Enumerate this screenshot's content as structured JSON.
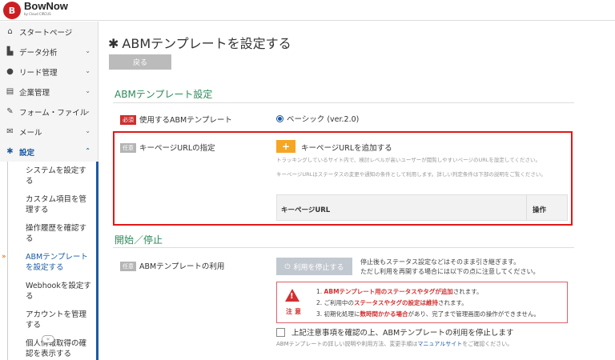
{
  "brand": {
    "name": "BowNow",
    "sub": "by Cloud CIRCUS",
    "mark": "B"
  },
  "sidebar": {
    "items": [
      {
        "label": "スタートページ",
        "icon": "home-icon",
        "glyph": "⌂",
        "chevron": false
      },
      {
        "label": "データ分析",
        "icon": "chart-icon",
        "glyph": "▙",
        "chevron": true
      },
      {
        "label": "リード管理",
        "icon": "person-icon",
        "glyph": "●",
        "chevron": true
      },
      {
        "label": "企業管理",
        "icon": "building-icon",
        "glyph": "▤",
        "chevron": true
      },
      {
        "label": "フォーム・ファイル",
        "icon": "edit-icon",
        "glyph": "✎",
        "chevron": true
      },
      {
        "label": "メール",
        "icon": "mail-icon",
        "glyph": "✉",
        "chevron": true
      },
      {
        "label": "設定",
        "icon": "gear-icon",
        "glyph": "✱",
        "chevron": true
      }
    ],
    "sub_items": [
      "システムを設定する",
      "カスタム項目を管理する",
      "操作履歴を確認する",
      "ABMテンプレートを設定する",
      "Webhookを設定する",
      "アカウントを管理する",
      "個人情報取得の確認を表示する"
    ],
    "collapse_label": "«"
  },
  "page": {
    "title": "ABMテンプレートを設定する",
    "back_label": "戻る"
  },
  "section1": {
    "title": "ABMテンプレート設定",
    "required_tag": "必須",
    "template_label": "使用するABMテンプレート",
    "template_value": "ベーシック (ver.2.0)",
    "optional_tag": "任意",
    "keypage_label": "キーページURLの指定",
    "add_button": "+",
    "add_label": "キーページURLを追加する",
    "help1": "トラッキングしているサイト内で、検討レベルが高いユーザーが閲覧しやすいページのURLを設定してください。",
    "help2": "キーページURLはステータスの変更や通知の条件として利用します。詳しい判定条件は下部の説明をご覧ください。",
    "table_headers": [
      "キーページURL",
      "操作"
    ]
  },
  "section2": {
    "title": "開始／停止",
    "optional_tag": "任意",
    "usage_label": "ABMテンプレートの利用",
    "stop_button": "利用を停止する",
    "note1": "停止後もステータス設定などはそのまま引き継ぎます。",
    "note2": "ただし利用を再開する場合には以下の点に注意してください。",
    "caution_title": "注意",
    "caution_lines": [
      {
        "n": "1.",
        "strong": "ABMテンプレート用のステータスやタグが追加",
        "rest": "されます。",
        "pre": ""
      },
      {
        "n": "2.",
        "pre": "ご利用中の",
        "strong": "ステータスやタグの設定は維持",
        "rest": "されます。"
      },
      {
        "n": "3.",
        "pre": "初期化処理に",
        "strong": "数時間かかる場合",
        "rest": "があり、完了まで管理画面の操作ができません。"
      }
    ],
    "confirm_label": "上記注意事項を確認の上、ABMテンプレートの利用を停止します",
    "foot_pre": "ABMテンプレートの詳しい説明や利用方法、変更手順は",
    "foot_link": "マニュアルサイト",
    "foot_post": "をご確認ください。"
  }
}
